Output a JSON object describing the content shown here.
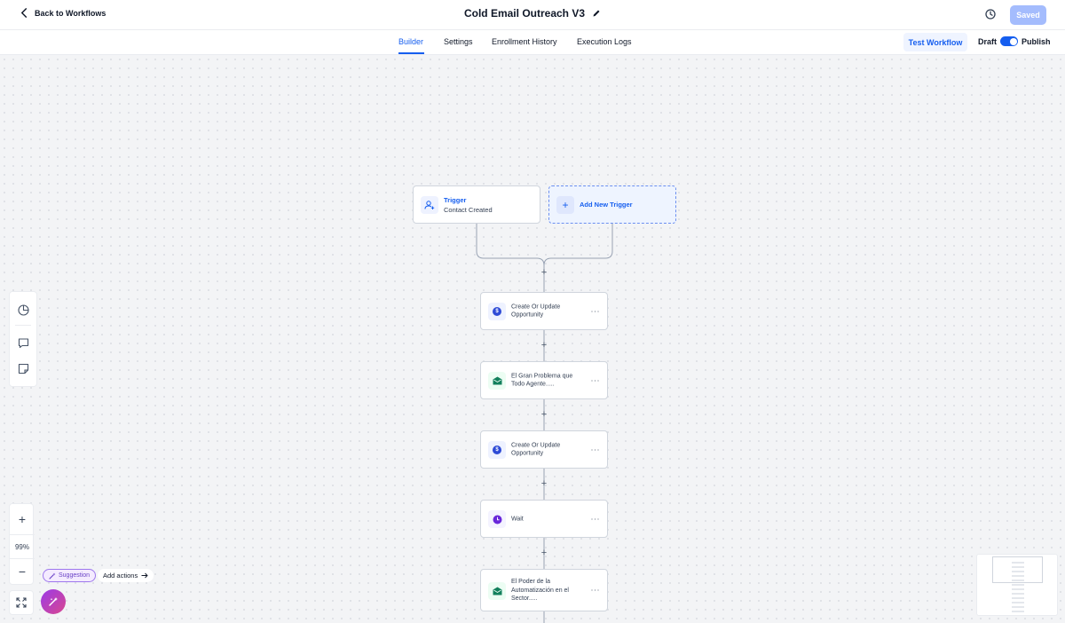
{
  "header": {
    "back_label": "Back to Workflows",
    "title": "Cold Email Outreach V3",
    "saved_label": "Saved"
  },
  "tabs": [
    {
      "label": "Builder",
      "active": true
    },
    {
      "label": "Settings",
      "active": false
    },
    {
      "label": "Enrollment History",
      "active": false
    },
    {
      "label": "Execution Logs",
      "active": false
    }
  ],
  "actions_bar": {
    "test_label": "Test Workflow",
    "draft_label": "Draft",
    "publish_label": "Publish",
    "publish_on": true
  },
  "trigger": {
    "title": "Trigger",
    "subtitle": "Contact Created",
    "icon": "user-plus-icon"
  },
  "add_trigger_label": "Add New Trigger",
  "steps": [
    {
      "label": "Create Or Update Opportunity",
      "icon": "dollar-icon"
    },
    {
      "label": "El Gran Problema que Todo Agente.....",
      "icon": "mail-icon"
    },
    {
      "label": "Create Or Update Opportunity",
      "icon": "dollar-icon"
    },
    {
      "label": "Wait",
      "icon": "clock-icon"
    },
    {
      "label": "El Poder de la Automatización en el Sector.....",
      "icon": "mail-icon"
    }
  ],
  "zoom": {
    "value": "99%"
  },
  "suggestion": {
    "badge_label": "Suggestion",
    "action_label": "Add actions"
  },
  "colors": {
    "accent": "#155eef",
    "saved_button": "#a4bcfd",
    "suggestion": "#6941c6"
  }
}
